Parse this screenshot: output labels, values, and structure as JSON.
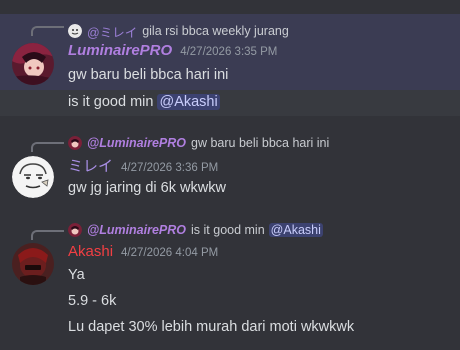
{
  "messages": [
    {
      "reply": {
        "author": "@ミレイ",
        "text": "gila rsi bbca weekly jurang"
      },
      "author": "LuminairePRO",
      "timestamp": "4/27/2026 3:35 PM",
      "lines": [
        "gw baru beli bbca hari ini"
      ]
    },
    {
      "text_before_mention": "is it good min",
      "mention": "@Akashi"
    },
    {
      "reply": {
        "author": "@LuminairePRO",
        "text": "gw baru beli bbca hari ini"
      },
      "author": "ミレイ",
      "timestamp": "4/27/2026 3:36 PM",
      "lines": [
        "gw jg jaring di 6k wkwkw"
      ]
    },
    {
      "reply": {
        "author": "@LuminairePRO",
        "text": "is it good min",
        "mention": "@Akashi"
      },
      "author": "Akashi",
      "timestamp": "4/27/2026 4:04 PM",
      "lines": [
        "Ya",
        "5.9 - 6k",
        "Lu dapet 30% lebih murah dari moti wkwkwk"
      ]
    }
  ],
  "colors": {
    "background": "#323339",
    "highlight": "#3b3c53",
    "luminaire_name": "#b07fe0",
    "mirei_name": "#a98fe6",
    "akashi_name": "#f23f43",
    "mention_bg": "#3c4270"
  },
  "icons": [
    "avatar-luminaire",
    "avatar-mirei",
    "avatar-akashi"
  ]
}
